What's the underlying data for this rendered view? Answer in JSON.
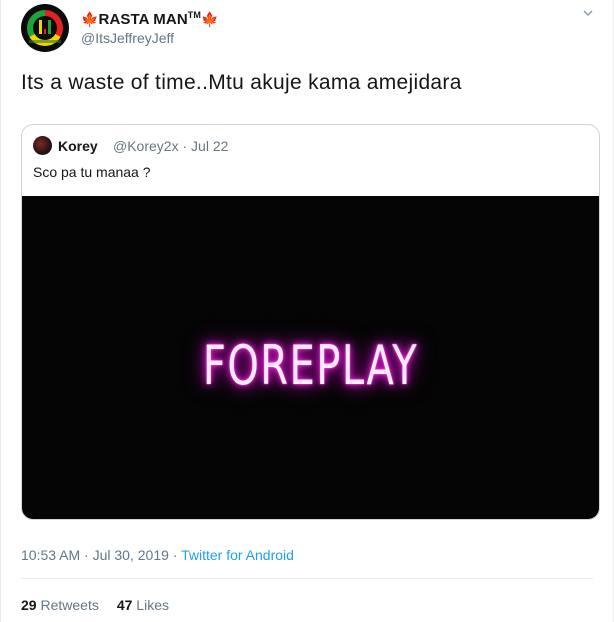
{
  "author": {
    "display_name": "RASTA MAN",
    "trademark": "TM",
    "flag_emoji": "🍁",
    "handle": "@ItsJeffreyJeff"
  },
  "tweet": {
    "text": "Its a waste of time..Mtu akuje kama amejidara"
  },
  "quoted": {
    "name": "Korey",
    "handle": "@Korey2x",
    "separator": " · ",
    "date": "Jul 22",
    "text": "Sco pa tu manaa ?",
    "media_text": "FOREPLAY"
  },
  "meta": {
    "time": "10:53 AM",
    "dot": " · ",
    "date": "Jul 30, 2019",
    "source": "Twitter for Android"
  },
  "stats": {
    "retweets_count": "29",
    "retweets_label": "Retweets",
    "likes_count": "47",
    "likes_label": "Likes"
  },
  "icons": {
    "caret": "chevron-down-icon",
    "avatar": "avatar"
  }
}
